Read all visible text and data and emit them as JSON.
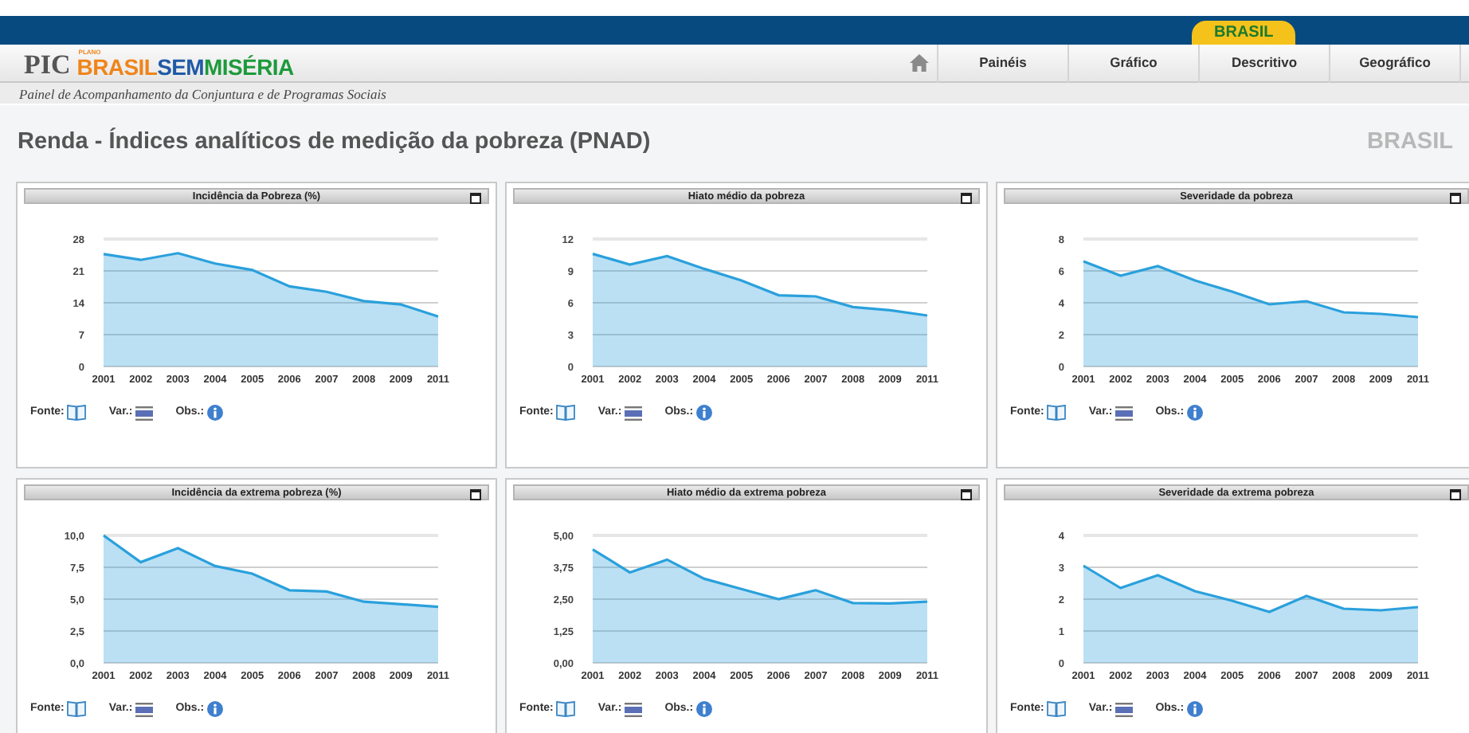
{
  "top_bar": {
    "tab": "BRASIL"
  },
  "logo": {
    "prefix": "PIC",
    "small": "PLANO",
    "parts": [
      {
        "text": "BRASIL",
        "color": "#f0841a"
      },
      {
        "text": "SEM",
        "color": "#1f5aa6"
      },
      {
        "text": "MISÉRIA",
        "color": "#1e9a3c"
      }
    ]
  },
  "nav": {
    "items": [
      {
        "label": "Painéis"
      },
      {
        "label": "Gráfico"
      },
      {
        "label": "Descritivo"
      },
      {
        "label": "Geográfico"
      }
    ]
  },
  "subtitle": "Painel de Acompanhamento da Conjuntura e de Programas Sociais",
  "page_title": "Renda - Índices analíticos de medição da pobreza (PNAD)",
  "region": "BRASIL",
  "panels": [
    {
      "title": "Incidência da Pobreza (%)",
      "chart_data": {
        "type": "area",
        "categories": [
          "2001",
          "2002",
          "2003",
          "2004",
          "2005",
          "2006",
          "2007",
          "2008",
          "2009",
          "2011"
        ],
        "series": [
          {
            "color": "#2aa0dc",
            "values": [
              24.7,
              23.4,
              24.9,
              22.6,
              21.2,
              17.6,
              16.4,
              14.4,
              13.6,
              11.0
            ]
          }
        ],
        "ylim": [
          0,
          28
        ],
        "yticks": [
          0,
          7,
          14,
          21,
          28
        ],
        "grid": true
      },
      "footer": [
        {
          "label": "Fonte:",
          "kind": "book"
        },
        {
          "label": "Var.:",
          "kind": "table"
        },
        {
          "label": "Obs.:",
          "kind": "info"
        }
      ]
    },
    {
      "title": "Hiato médio da pobreza",
      "chart_data": {
        "type": "area",
        "categories": [
          "2001",
          "2002",
          "2003",
          "2004",
          "2005",
          "2006",
          "2007",
          "2008",
          "2009",
          "2011"
        ],
        "series": [
          {
            "color": "#2aa0dc",
            "values": [
              10.6,
              9.6,
              10.4,
              9.2,
              8.1,
              6.7,
              6.6,
              5.6,
              5.3,
              4.8
            ]
          }
        ],
        "ylim": [
          0,
          12
        ],
        "yticks": [
          0,
          3,
          6,
          9,
          12
        ],
        "grid": true
      },
      "footer": [
        {
          "label": "Fonte:",
          "kind": "book"
        },
        {
          "label": "Var.:",
          "kind": "table"
        },
        {
          "label": "Obs.:",
          "kind": "info"
        }
      ]
    },
    {
      "title": "Severidade da pobreza",
      "chart_data": {
        "type": "area",
        "categories": [
          "2001",
          "2002",
          "2003",
          "2004",
          "2005",
          "2006",
          "2007",
          "2008",
          "2009",
          "2011"
        ],
        "series": [
          {
            "color": "#2aa0dc",
            "values": [
              6.6,
              5.7,
              6.3,
              5.4,
              4.7,
              3.9,
              4.1,
              3.4,
              3.3,
              3.1
            ]
          }
        ],
        "ylim": [
          0,
          8
        ],
        "yticks": [
          0,
          2,
          4,
          6,
          8
        ],
        "grid": true
      },
      "footer": [
        {
          "label": "Fonte:",
          "kind": "book"
        },
        {
          "label": "Var.:",
          "kind": "table"
        },
        {
          "label": "Obs.:",
          "kind": "info"
        }
      ]
    },
    {
      "title": "Incidência da extrema pobreza (%)",
      "chart_data": {
        "type": "area",
        "categories": [
          "2001",
          "2002",
          "2003",
          "2004",
          "2005",
          "2006",
          "2007",
          "2008",
          "2009",
          "2011"
        ],
        "series": [
          {
            "color": "#2aa0dc",
            "values": [
              10.0,
              7.9,
              9.0,
              7.6,
              7.0,
              5.7,
              5.6,
              4.8,
              4.6,
              4.4
            ]
          }
        ],
        "ylim": [
          0,
          10
        ],
        "yticks": [
          {
            "value": 0,
            "label": "0,0"
          },
          {
            "value": 2.5,
            "label": "2,5"
          },
          {
            "value": 5,
            "label": "5,0"
          },
          {
            "value": 7.5,
            "label": "7,5"
          },
          {
            "value": 10,
            "label": "10,0"
          }
        ],
        "grid": true
      },
      "footer": [
        {
          "label": "Fonte:",
          "kind": "book"
        },
        {
          "label": "Var.:",
          "kind": "table"
        },
        {
          "label": "Obs.:",
          "kind": "info"
        }
      ]
    },
    {
      "title": "Hiato médio da extrema pobreza",
      "chart_data": {
        "type": "area",
        "categories": [
          "2001",
          "2002",
          "2003",
          "2004",
          "2005",
          "2006",
          "2007",
          "2008",
          "2009",
          "2011"
        ],
        "series": [
          {
            "color": "#2aa0dc",
            "values": [
              4.45,
              3.55,
              4.05,
              3.3,
              2.9,
              2.5,
              2.85,
              2.35,
              2.33,
              2.4
            ]
          }
        ],
        "ylim": [
          0,
          5
        ],
        "yticks": [
          {
            "value": 0,
            "label": "0,00"
          },
          {
            "value": 1.25,
            "label": "1,25"
          },
          {
            "value": 2.5,
            "label": "2,50"
          },
          {
            "value": 3.75,
            "label": "3,75"
          },
          {
            "value": 5,
            "label": "5,00"
          }
        ],
        "grid": true
      },
      "footer": [
        {
          "label": "Fonte:",
          "kind": "book"
        },
        {
          "label": "Var.:",
          "kind": "table"
        },
        {
          "label": "Obs.:",
          "kind": "info"
        }
      ]
    },
    {
      "title": "Severidade da extrema pobreza",
      "chart_data": {
        "type": "area",
        "categories": [
          "2001",
          "2002",
          "2003",
          "2004",
          "2005",
          "2006",
          "2007",
          "2008",
          "2009",
          "2011"
        ],
        "series": [
          {
            "color": "#2aa0dc",
            "values": [
              3.05,
              2.35,
              2.75,
              2.25,
              1.95,
              1.6,
              2.1,
              1.7,
              1.65,
              1.75
            ]
          }
        ],
        "ylim": [
          0,
          4
        ],
        "yticks": [
          0,
          1,
          2,
          3,
          4
        ],
        "grid": true
      },
      "footer": [
        {
          "label": "Fonte:",
          "kind": "book"
        },
        {
          "label": "Var.:",
          "kind": "table"
        },
        {
          "label": "Obs.:",
          "kind": "info"
        }
      ]
    }
  ]
}
